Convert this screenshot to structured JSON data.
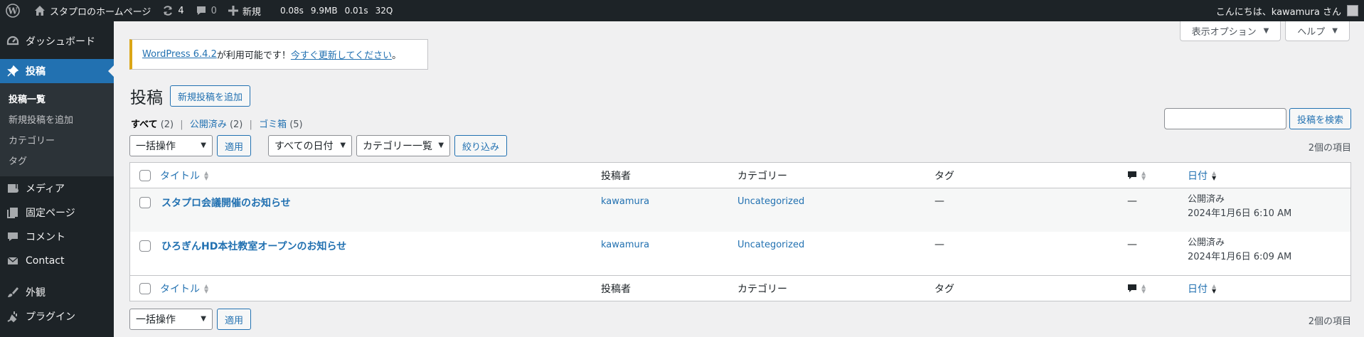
{
  "adminbar": {
    "site_name": "スタプロのホームページ",
    "updates_count": "4",
    "comments_count": "0",
    "new_label": "新規",
    "perf": [
      "0.08s",
      "9.9MB",
      "0.01s",
      "32Q"
    ],
    "greeting": "こんにちは、kawamura さん"
  },
  "sidebar": {
    "dashboard": "ダッシュボード",
    "posts": "投稿",
    "submenu": [
      "投稿一覧",
      "新規投稿を追加",
      "カテゴリー",
      "タグ"
    ],
    "media": "メディア",
    "pages": "固定ページ",
    "comments": "コメント",
    "contact": "Contact",
    "appearance": "外観",
    "plugins": "プラグイン"
  },
  "screen_meta": {
    "options": "表示オプション",
    "help": "ヘルプ"
  },
  "notice": {
    "version_link": "WordPress 6.4.2",
    "middle": " が利用可能です！",
    "update_link": "今すぐ更新してください",
    "end": "。"
  },
  "page": {
    "title": "投稿",
    "add_new": "新規投稿を追加"
  },
  "views": {
    "all": "すべて",
    "all_count": "(2)",
    "published": "公開済み",
    "published_count": "(2)",
    "trash": "ゴミ箱",
    "trash_count": "(5)"
  },
  "search": {
    "button": "投稿を検索"
  },
  "filters": {
    "bulk": "一括操作",
    "apply": "適用",
    "dates": "すべての日付",
    "categories": "カテゴリー一覧",
    "filter": "絞り込み",
    "items_count": "2個の項目"
  },
  "table": {
    "columns": {
      "title": "タイトル",
      "author": "投稿者",
      "categories": "カテゴリー",
      "tags": "タグ",
      "date": "日付"
    },
    "rows": [
      {
        "title": "スタプロ会議開催のお知らせ",
        "author": "kawamura",
        "category": "Uncategorized",
        "tags": "—",
        "comments": "—",
        "status": "公開済み",
        "date": "2024年1月6日 6:10 AM"
      },
      {
        "title": "ひろぎんHD本社教室オープンのお知らせ",
        "author": "kawamura",
        "category": "Uncategorized",
        "tags": "—",
        "comments": "—",
        "status": "公開済み",
        "date": "2024年1月6日 6:09 AM"
      }
    ]
  },
  "colors": {
    "adminbar_bg": "#1d2327",
    "accent": "#2271b1",
    "notice_warning": "#dba617"
  }
}
